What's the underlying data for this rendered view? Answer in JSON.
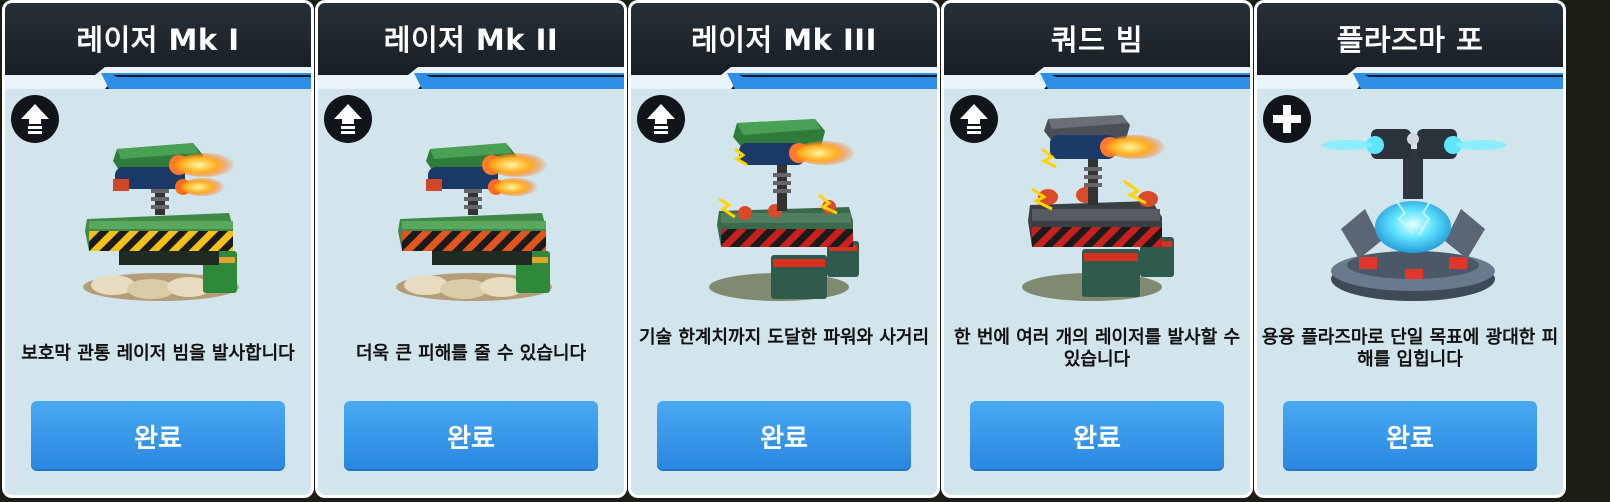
{
  "cards": [
    {
      "title": "레이저 Mk I",
      "description": "보호막 관통 레이저 빔을 발사합니다",
      "status_icon": "upgrade-arrow-icon",
      "button_label": "완료"
    },
    {
      "title": "레이저 Mk II",
      "description": "더욱 큰 피해를 줄 수 있습니다",
      "status_icon": "upgrade-arrow-icon",
      "button_label": "완료"
    },
    {
      "title": "레이저 Mk III",
      "description": "기술 한계치까지 도달한 파워와 사거리",
      "status_icon": "upgrade-arrow-icon",
      "button_label": "완료"
    },
    {
      "title": "쿼드 빔",
      "description": "한 번에 여러 개의 레이저를 발사할 수 있습니다",
      "status_icon": "upgrade-arrow-icon",
      "button_label": "완료"
    },
    {
      "title": "플라즈마 포",
      "description": "용융 플라즈마로 단일 목표에 광대한 피해를 입힙니다",
      "status_icon": "plus-icon",
      "button_label": "완료"
    }
  ],
  "colors": {
    "card_bg": "#d3e5ec",
    "header_bg": "#1c242b",
    "accent_stripe": "#2f8fe6",
    "button": "#3b9cec",
    "hazard_yellow": "#f2c21a",
    "hazard_orange": "#e0561e",
    "hazard_red": "#c81f1f"
  }
}
